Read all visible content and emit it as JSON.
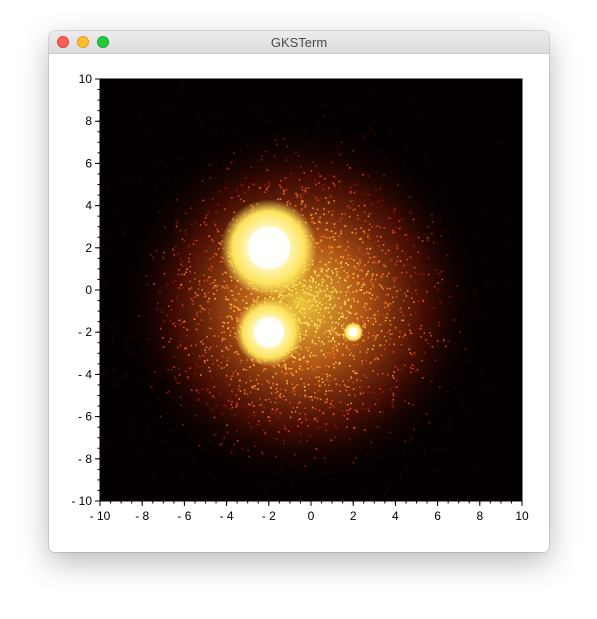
{
  "window": {
    "title": "GKSTerm",
    "controls": [
      "close-button",
      "minimize-button",
      "zoom-button"
    ]
  },
  "colors": {
    "colormap": [
      "#050000",
      "#3a0000",
      "#8a1a08",
      "#d8401a",
      "#f07a2a",
      "#f8b53a",
      "#fde35a",
      "#ffff9a",
      "#ffffff"
    ],
    "background": "#050000"
  },
  "chart_data": {
    "type": "heatmap",
    "title": "",
    "xlabel": "",
    "ylabel": "",
    "xlim": [
      -10,
      10
    ],
    "ylim": [
      -10,
      10
    ],
    "x_ticks": [
      -10,
      -8,
      -6,
      -4,
      -2,
      0,
      2,
      4,
      6,
      8,
      10
    ],
    "y_ticks": [
      -10,
      -8,
      -6,
      -4,
      -2,
      0,
      2,
      4,
      6,
      8,
      10
    ],
    "x_tick_labels": [
      "- 10",
      "- 8",
      "- 6",
      "- 4",
      "- 2",
      "0",
      "2",
      "4",
      "6",
      "8",
      "10"
    ],
    "y_tick_labels": [
      "- 10",
      "- 8",
      "- 6",
      "- 4",
      "- 2",
      "0",
      "2",
      "4",
      "6",
      "8",
      "10"
    ],
    "grid": false,
    "colorbar": false,
    "hotspots": [
      {
        "x": -2,
        "y": 2,
        "intensity": 1.0,
        "radius": 1.7
      },
      {
        "x": -2,
        "y": -2,
        "intensity": 1.0,
        "radius": 1.2
      },
      {
        "x": 2,
        "y": -2,
        "intensity": 1.0,
        "radius": 0.35
      }
    ]
  }
}
